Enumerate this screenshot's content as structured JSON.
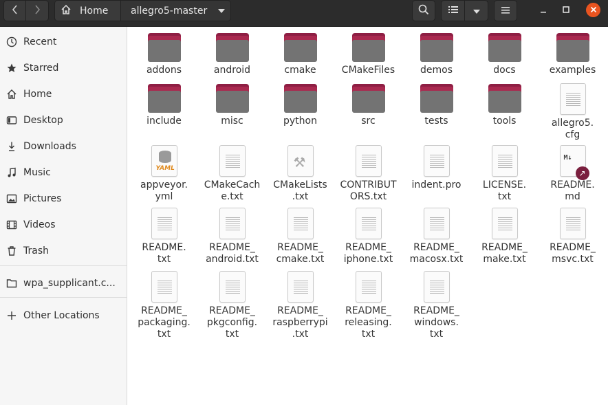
{
  "header": {
    "back_icon": "chevron-left-icon",
    "forward_icon": "chevron-right-icon",
    "home_label": "Home",
    "current_folder": "allegro5-master"
  },
  "sidebar": {
    "items": [
      {
        "label": "Recent",
        "icon": "clock-icon"
      },
      {
        "label": "Starred",
        "icon": "star-icon"
      },
      {
        "label": "Home",
        "icon": "home-icon"
      },
      {
        "label": "Desktop",
        "icon": "desktop-icon"
      },
      {
        "label": "Downloads",
        "icon": "download-icon"
      },
      {
        "label": "Music",
        "icon": "music-icon"
      },
      {
        "label": "Pictures",
        "icon": "pictures-icon"
      },
      {
        "label": "Videos",
        "icon": "video-icon"
      },
      {
        "label": "Trash",
        "icon": "trash-icon"
      },
      {
        "label": "wpa_supplicant.c...",
        "icon": "folder-icon"
      },
      {
        "label": "Other Locations",
        "icon": "plus-icon"
      }
    ]
  },
  "files": [
    {
      "name": "addons",
      "type": "folder"
    },
    {
      "name": "android",
      "type": "folder"
    },
    {
      "name": "cmake",
      "type": "folder"
    },
    {
      "name": "CMakeFiles",
      "type": "folder"
    },
    {
      "name": "demos",
      "type": "folder"
    },
    {
      "name": "docs",
      "type": "folder"
    },
    {
      "name": "examples",
      "type": "folder"
    },
    {
      "name": "include",
      "type": "folder"
    },
    {
      "name": "misc",
      "type": "folder"
    },
    {
      "name": "python",
      "type": "folder"
    },
    {
      "name": "src",
      "type": "folder"
    },
    {
      "name": "tests",
      "type": "folder"
    },
    {
      "name": "tools",
      "type": "folder"
    },
    {
      "name": "allegro5.\ncfg",
      "type": "text"
    },
    {
      "name": "appveyor.\nyml",
      "type": "yaml"
    },
    {
      "name": "CMakeCach\ne.txt",
      "type": "text"
    },
    {
      "name": "CMakeLists\n.txt",
      "type": "cmake"
    },
    {
      "name": "CONTRIBUT\nORS.txt",
      "type": "text"
    },
    {
      "name": "indent.pro",
      "type": "text"
    },
    {
      "name": "LICENSE.\ntxt",
      "type": "text"
    },
    {
      "name": "README.\nmd",
      "type": "markdown"
    },
    {
      "name": "README.\ntxt",
      "type": "text"
    },
    {
      "name": "README_\nandroid.txt",
      "type": "text"
    },
    {
      "name": "README_\ncmake.txt",
      "type": "text"
    },
    {
      "name": "README_\niphone.txt",
      "type": "text"
    },
    {
      "name": "README_\nmacosx.txt",
      "type": "text"
    },
    {
      "name": "README_\nmake.txt",
      "type": "text"
    },
    {
      "name": "README_\nmsvc.txt",
      "type": "text"
    },
    {
      "name": "README_\npackaging.\ntxt",
      "type": "text"
    },
    {
      "name": "README_\npkgconfig.\ntxt",
      "type": "text"
    },
    {
      "name": "README_\nraspberrypi\n.txt",
      "type": "text"
    },
    {
      "name": "README_\nreleasing.\ntxt",
      "type": "text"
    },
    {
      "name": "README_\nwindows.\ntxt",
      "type": "text"
    }
  ],
  "md_badge_text": "M↓",
  "yaml_badge_text": "YAML"
}
